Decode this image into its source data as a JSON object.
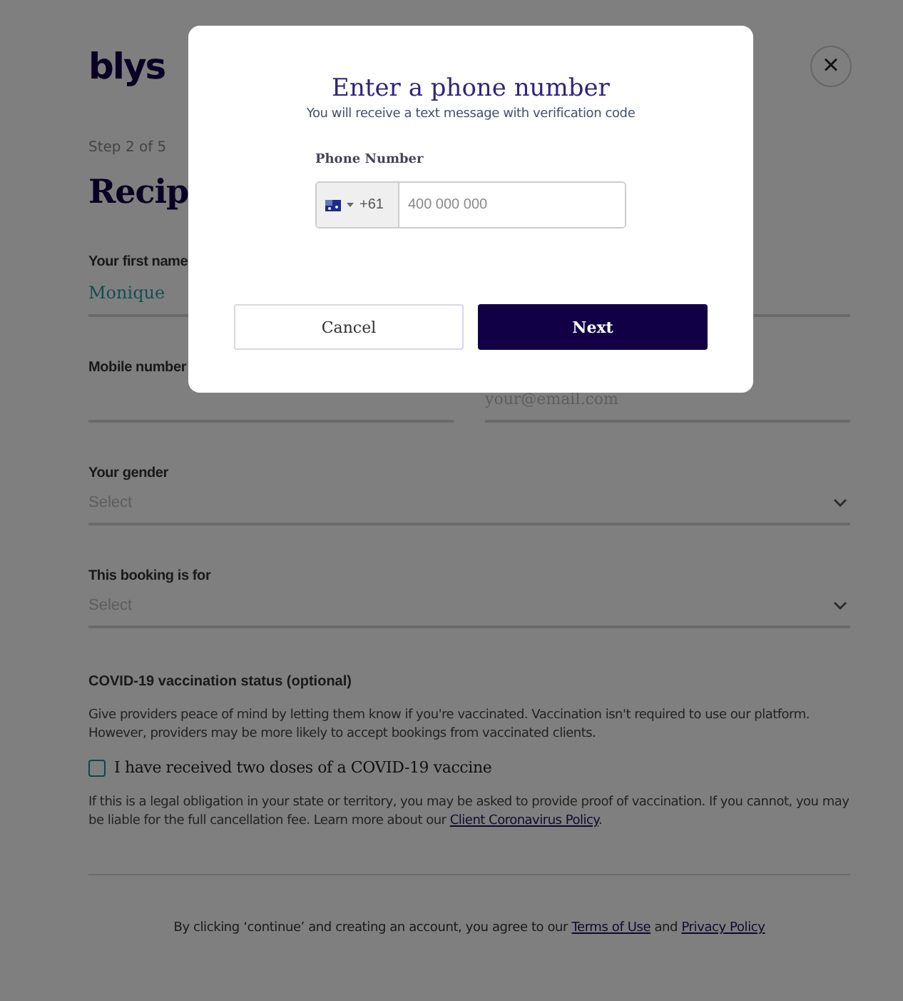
{
  "header": {
    "logo": "blys",
    "close": "×"
  },
  "step": "Step 2 of 5",
  "title": "Recip",
  "rows": [
    [
      {
        "kind": "text",
        "label": "Your first name",
        "value": "Monique"
      }
    ],
    [
      {
        "kind": "text",
        "label": "Mobile number"
      },
      {
        "kind": "text",
        "placeholder": "your@email.com"
      }
    ],
    [
      {
        "kind": "select",
        "label": "Your gender",
        "placeholder": "Select"
      }
    ],
    [
      {
        "kind": "select",
        "label": "This booking is for",
        "placeholder": "Select"
      }
    ]
  ],
  "covid": {
    "heading": "COVID-19 vaccination status (optional)",
    "text": "Give providers peace of mind by letting them know if you're vaccinated. Vaccination isn't required to use our platform. However, providers may be more likely to accept bookings from vaccinated clients.",
    "checkbox": {
      "label": "I have received two doses of a COVID-19 vaccine",
      "checked": false
    },
    "note": "If this is a legal obligation in your state or territory, you may be asked to provide proof of vaccination. If you cannot, you may be liable for the full cancellation fee. Learn more about our ",
    "note_link": "Client Coronavirus Policy",
    "note_end": "."
  },
  "footer": {
    "text": "By clicking ‘continue’ and creating an account, you agree to our ",
    "terms_link": "Terms of Use",
    "joiner": " and ",
    "privacy_link": "Privacy Policy"
  },
  "modal": {
    "title": "Enter a phone number",
    "subtitle": "You will receive a text message with verification code",
    "label": "Phone Number",
    "code": "+61",
    "placeholder": "400 000 000",
    "buttons": [
      {
        "kind": "secondary",
        "label": "Cancel"
      },
      {
        "kind": "primary",
        "label": "Next"
      }
    ]
  }
}
